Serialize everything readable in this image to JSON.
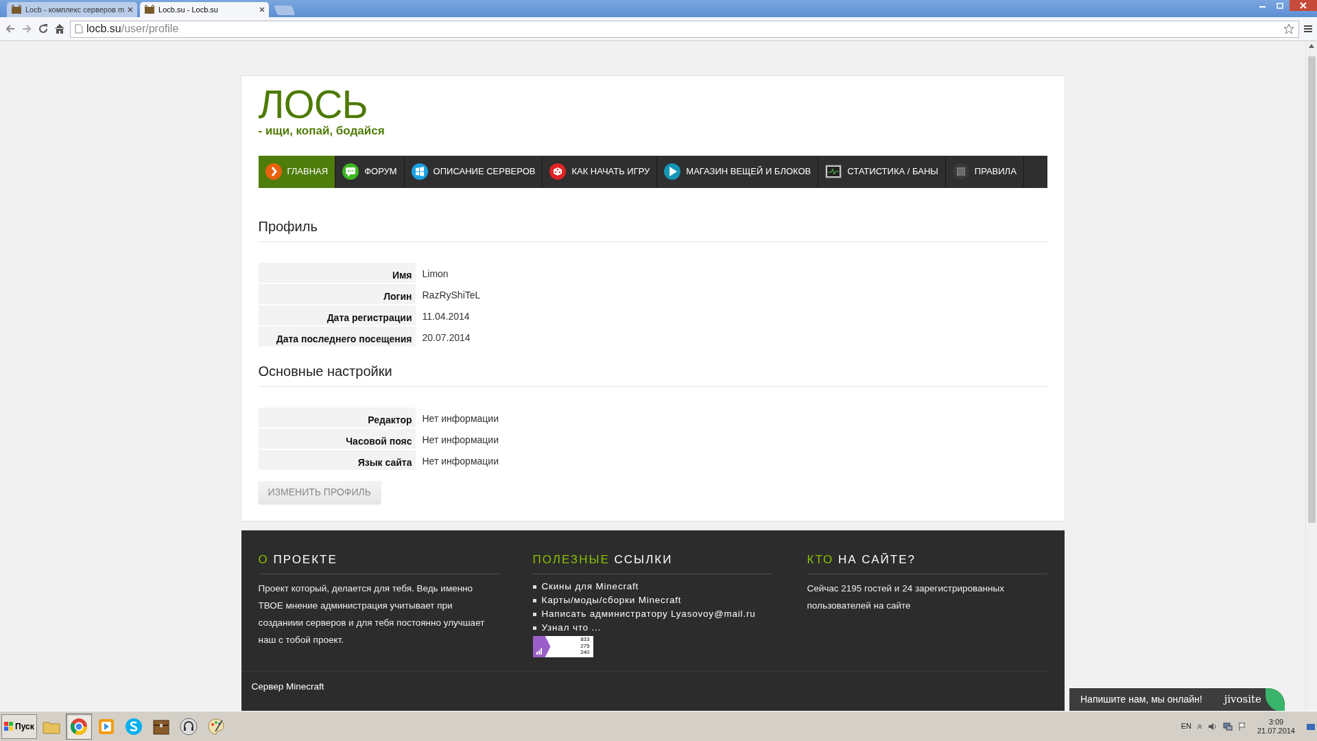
{
  "browser": {
    "tabs": [
      {
        "title": "Locb - комплекс серверов m",
        "selected": false
      },
      {
        "title": "Locb.su - Locb.su",
        "selected": true
      }
    ],
    "address": {
      "host": "locb.su",
      "path": "/user/profile"
    }
  },
  "site": {
    "logo": "ЛОСЬ",
    "tagline": "- ищи, копай, бодайся",
    "nav": [
      {
        "label": "ГЛАВНАЯ",
        "kind": "chevron",
        "selected": true
      },
      {
        "label": "ФОРУМ",
        "kind": "chat",
        "selected": false
      },
      {
        "label": "ОПИСАНИЕ СЕРВЕРОВ",
        "kind": "windows",
        "selected": false
      },
      {
        "label": "КАК НАЧАТЬ ИГРУ",
        "kind": "dice",
        "selected": false
      },
      {
        "label": "МАГАЗИН ВЕЩЕЙ И БЛОКОВ",
        "kind": "play",
        "selected": false
      },
      {
        "label": "СТАТИСТИКА / БАНЫ",
        "kind": "monitor",
        "selected": false
      },
      {
        "label": "ПРАВИЛА",
        "kind": "grid",
        "selected": false
      }
    ]
  },
  "profile": {
    "heading": "Профиль",
    "fields": [
      {
        "label": "Имя",
        "value": "Limon"
      },
      {
        "label": "Логин",
        "value": "RazRyShiTeL"
      },
      {
        "label": "Дата регистрации",
        "value": "11.04.2014"
      },
      {
        "label": "Дата последнего посещения",
        "value": "20.07.2014"
      }
    ]
  },
  "settings": {
    "heading": "Основные настройки",
    "fields": [
      {
        "label": "Редактор",
        "value": "Нет информации"
      },
      {
        "label": "Часовой пояс",
        "value": "Нет информации"
      },
      {
        "label": "Язык сайта",
        "value": "Нет информации"
      }
    ]
  },
  "edit_button": {
    "label": "ИЗМЕНИТЬ ПРОФИЛЬ",
    "disabled": true
  },
  "footer": {
    "columns": [
      {
        "accent": "О",
        "title": "ПРОЕКТЕ",
        "kind": "text",
        "text": "Проект который, делается для тебя. Ведь именно ТВОЕ мнение администрация учитывает при созданиии серверов и для тебя постоянно улучшает наш с тобой проект."
      },
      {
        "accent": "ПОЛЕЗНЫЕ",
        "title": "ССЫЛКИ",
        "kind": "links",
        "links": [
          "Скины для Minecraft",
          "Карты/моды/сборки Minecraft",
          "Написать администратору Lyasovoy@mail.ru",
          "Узнал что ..."
        ],
        "counter": [
          "833",
          "275",
          "240"
        ]
      },
      {
        "accent": "КТО",
        "title": "НА САЙТЕ?",
        "kind": "text",
        "text": "Сейчас 2195 гостей и 24 зарегистрированных пользователей на сайте"
      }
    ],
    "bottom_text": "Сервер Minecraft"
  },
  "chat_widget": {
    "text": "Напишите нам, мы онлайн!",
    "brand": "jivosite"
  },
  "taskbar": {
    "start": "Пуск",
    "apps": [
      {
        "kind": "folder",
        "selected": false
      },
      {
        "kind": "chrome",
        "selected": true
      },
      {
        "kind": "media",
        "selected": false
      },
      {
        "kind": "skype",
        "selected": false
      },
      {
        "kind": "chest",
        "selected": false
      },
      {
        "kind": "headset",
        "selected": false
      },
      {
        "kind": "paint",
        "selected": false
      }
    ],
    "language": "EN",
    "time": "3:09",
    "date": "21.07.2014"
  }
}
